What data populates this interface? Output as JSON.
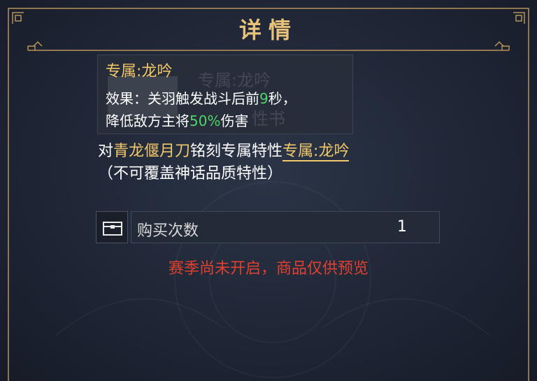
{
  "dialog": {
    "title": "详情"
  },
  "item": {
    "trait_name": "专属:龙吟",
    "ghost_title": "专属:龙吟",
    "ghost_text": "性书",
    "effect_line1_pre": "效果：关羽触发战斗后前",
    "effect_line1_num": "9",
    "effect_line1_post": "秒，",
    "effect_line2_pre": "降低敌方主将",
    "effect_line2_num": "50%",
    "effect_line2_post": "伤害"
  },
  "engrave": {
    "prefix": "对",
    "weapon": "青龙偃月刀",
    "middle": "铭刻专属特性",
    "trait_link": "专属:龙吟",
    "note": "（不可覆盖神话品质特性）"
  },
  "purchase": {
    "label": "购买次数",
    "count": "1",
    "icon": "chest-icon"
  },
  "notice": "赛季尚未开启，商品仅供预览",
  "colors": {
    "gold": "#f2c86b",
    "highlight_green": "#4fd46a",
    "warning_red": "#e0402f",
    "border_gold": "#b8945a"
  }
}
